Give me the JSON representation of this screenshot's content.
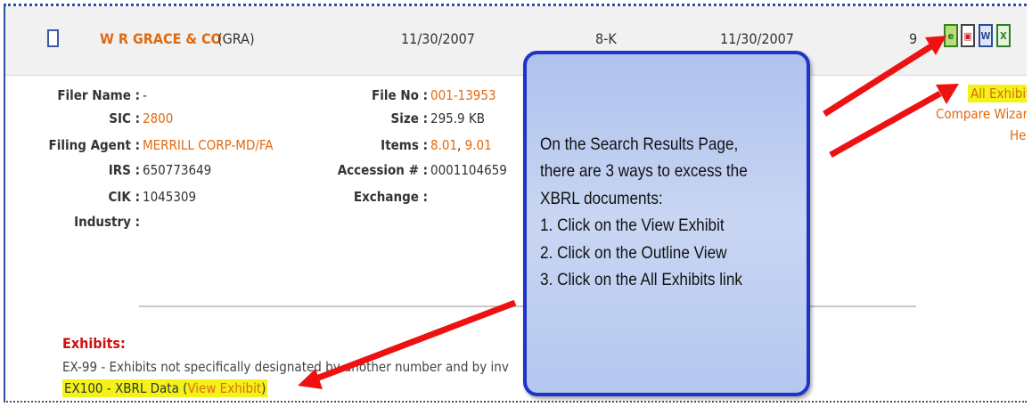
{
  "row": {
    "company": "W R GRACE & CO",
    "ticker": "(GRA)",
    "filed_date": "11/30/2007",
    "form": "8-K",
    "period_date": "11/30/2007",
    "pages": "9"
  },
  "details_left": [
    {
      "label": "Filer Name :",
      "value": "-"
    },
    {
      "label": "SIC :",
      "value": "2800"
    },
    {
      "label": "Filing Agent :",
      "value": "MERRILL CORP-MD/FA"
    },
    {
      "label": "IRS :",
      "value": "650773649"
    },
    {
      "label": "CIK :",
      "value": "1045309"
    },
    {
      "label": "Industry :",
      "value": ""
    }
  ],
  "details_mid": [
    {
      "label": "File No :",
      "value": "001-13953"
    },
    {
      "label": "Size :",
      "value": "295.9 KB"
    },
    {
      "label": "Items :",
      "value": "8.01, 9.01"
    },
    {
      "label": "Accession # :",
      "value": "0001104659"
    },
    {
      "label": "Exchange :",
      "value": ""
    }
  ],
  "items_parts": {
    "a": "8.01",
    "sep": ", ",
    "b": "9.01"
  },
  "links": {
    "all_exhibits": "All Exhibits",
    "compare_wizard": "Compare Wizard",
    "header": "Header"
  },
  "exhibits": {
    "title": "Exhibits:",
    "line1": "EX-99 - Exhibits not specifically designated by another number and by inv",
    "line2_prefix": "EX100 - XBRL Data (",
    "line2_link": "View Exhibit",
    "line2_suffix": ")"
  },
  "callout": {
    "lines": [
      "On the Search Results Page,",
      "there are 3 ways to excess the",
      "XBRL documents:",
      "1. Click on the View Exhibit",
      "2. Click on the Outline View",
      "3. Click on the All Exhibits link"
    ]
  },
  "icons": [
    "excel-view-icon",
    "pdf-icon",
    "word-icon",
    "xls-icon"
  ],
  "colors": {
    "link": "#e06a10",
    "highlight": "#f3f31a",
    "arrow": "#ee1111",
    "callout_border": "#1f33c8"
  }
}
